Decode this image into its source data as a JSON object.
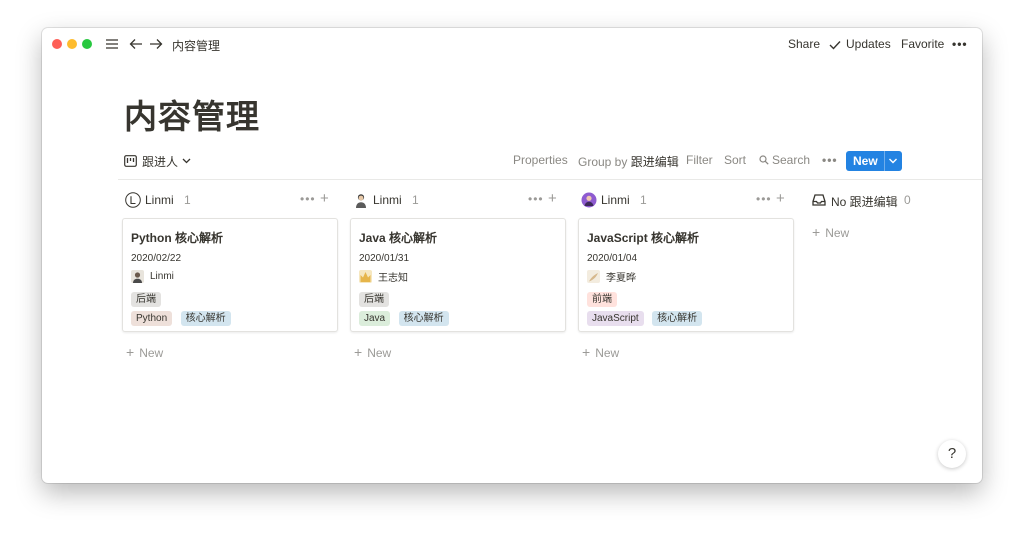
{
  "topbar": {
    "breadcrumb": "内容管理",
    "share": "Share",
    "updates": "Updates",
    "favorite": "Favorite",
    "more": "•••"
  },
  "page": {
    "title": "内容管理"
  },
  "view": {
    "name": "跟进人"
  },
  "toolbar": {
    "properties": "Properties",
    "group_by_label": "Group by",
    "group_by_value": "跟进编辑",
    "filter": "Filter",
    "sort": "Sort",
    "search": "Search",
    "more": "•••",
    "new": "New"
  },
  "columns": [
    {
      "name": "Linmi",
      "count": "1",
      "avatar_icon": "letter-L-avatar-icon",
      "card": {
        "title": "Python 核心解析",
        "date": "2020/02/22",
        "person": "Linmi",
        "tags_row1": [
          "后端"
        ],
        "tags_row2": [
          "Python",
          "核心解析"
        ]
      },
      "new": "New"
    },
    {
      "name": "Linmi",
      "count": "1",
      "avatar_icon": "person-avatar-icon",
      "card": {
        "title": "Java 核心解析",
        "date": "2020/01/31",
        "person": "王志知",
        "tags_row1": [
          "后端"
        ],
        "tags_row2": [
          "Java",
          "核心解析"
        ]
      },
      "new": "New"
    },
    {
      "name": "Linmi",
      "count": "1",
      "avatar_icon": "purple-avatar-icon",
      "card": {
        "title": "JavaScript 核心解析",
        "date": "2020/01/04",
        "person": "李夏晔",
        "tags_row1": [
          "前端"
        ],
        "tags_row2": [
          "JavaScript",
          "核心解析"
        ]
      },
      "new": "New"
    },
    {
      "name": "No 跟进编辑",
      "count": "0",
      "avatar_icon": "inbox-icon",
      "new": "New"
    }
  ],
  "help": "?",
  "colors": {
    "accent": "#2383e2",
    "tag_gray": "#e3e2e0",
    "tag_brown": "#eee0da",
    "tag_blue": "#d3e5ef",
    "tag_green": "#dbeddb",
    "tag_red": "#ffe2dd",
    "tag_purple": "#e8deee"
  }
}
